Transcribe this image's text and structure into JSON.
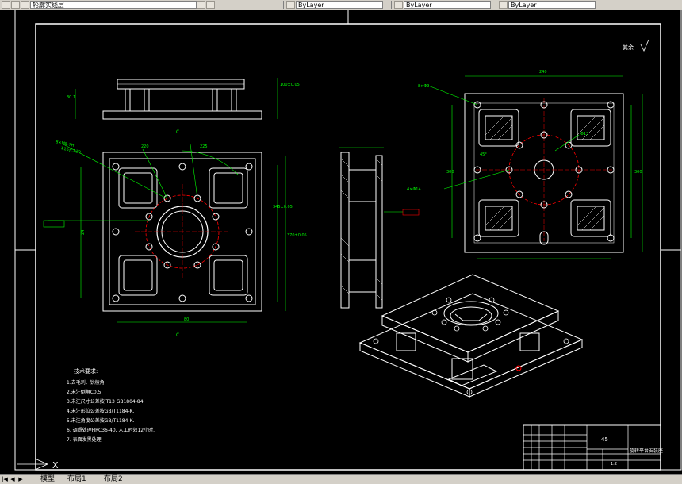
{
  "toolbar": {
    "layer_name": "轮廓实线层",
    "color_combo": "ByLayer",
    "linetype_combo": "ByLayer",
    "lineweight_combo": "ByLayer"
  },
  "drawing": {
    "roughness_note": "其余",
    "tech_title": "技术要求:",
    "tech_items": [
      "1.去毛刺、锐棱角.",
      "2.未注倒角C0.5.",
      "3.未注尺寸公差按IT13 GB1804-84.",
      "4.未注形位公差按GB/T1184-K.",
      "5.未注角度公差按GB/T1184-K.",
      "6. 调质处理HRC36-40, 人工时效12小时.",
      "7. 表面发黑处理."
    ],
    "title_block": {
      "part_name": "旋转平台安装座",
      "material": "45",
      "scale": "1:2"
    },
    "callouts": {
      "thread_hole_left": "8×M8-7H",
      "thread_hole_left2": "↧16孔↧20",
      "dim_top_width": "225",
      "dim_inner": "345±0.05",
      "dim_outer": "370±0.05",
      "dim_height": "220",
      "right_hole": "8×Φ9",
      "right_hole2": "4×Φ14",
      "right_hole3": "Φ13",
      "right_angle": "45°",
      "dim_right_h": "300",
      "dim_right_w": "300",
      "dim_right_inner": "240"
    }
  },
  "tabs": {
    "model": "模型",
    "layout1": "布局1",
    "layout2": "布局2"
  },
  "ucs_label": "X"
}
